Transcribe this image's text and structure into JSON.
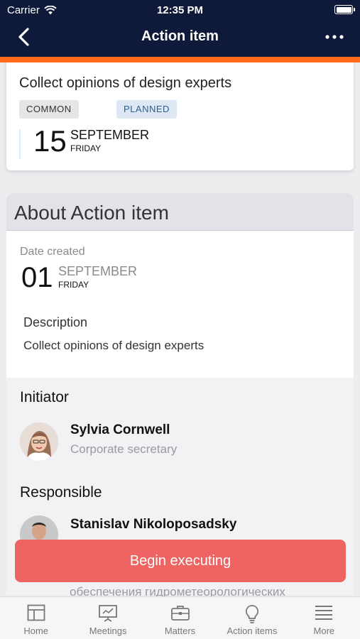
{
  "status_bar": {
    "carrier": "Carrier",
    "time": "12:35 PM"
  },
  "nav": {
    "title": "Action item",
    "back_icon": "chevron-left-icon",
    "more_icon": "more-dots-icon"
  },
  "colors": {
    "navy": "#0f1a3a",
    "accent_orange": "#ff6b1a",
    "button_red": "#ee6463"
  },
  "item": {
    "title": "Collect opinions of design experts",
    "tags": [
      "COMMON",
      "PLANNED"
    ],
    "due": {
      "day": "15",
      "month": "SEPTEMBER",
      "weekday": "FRIDAY"
    }
  },
  "about": {
    "heading": "About Action item",
    "date_created_label": "Date created",
    "created": {
      "day": "01",
      "month": "SEPTEMBER",
      "weekday": "FRIDAY"
    },
    "description_label": "Description",
    "description": "Collect opinions of design experts"
  },
  "initiator": {
    "heading": "Initiator",
    "name": "Sylvia Cornwell",
    "role": "Corporate secretary"
  },
  "responsible": {
    "heading": "Responsible",
    "name": "Stanislav Nikoloposadsky",
    "role_partial": "обеспечения гидрометеорологических"
  },
  "begin_button": "Begin executing",
  "tabs": [
    {
      "label": "Home",
      "icon": "home-icon"
    },
    {
      "label": "Meetings",
      "icon": "meetings-icon"
    },
    {
      "label": "Matters",
      "icon": "briefcase-icon"
    },
    {
      "label": "Action items",
      "icon": "lightbulb-icon"
    },
    {
      "label": "More",
      "icon": "menu-icon"
    }
  ]
}
